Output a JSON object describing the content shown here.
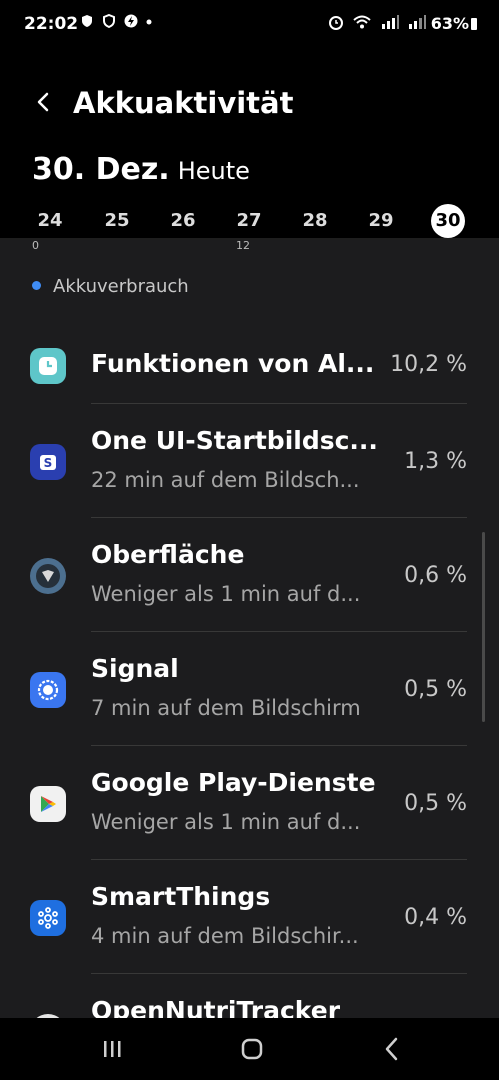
{
  "status_bar": {
    "time": "22:02",
    "battery": "63%"
  },
  "header": {
    "title": "Akkuaktivität"
  },
  "date": {
    "main": "30. Dez.",
    "sub": "Heute"
  },
  "days": [
    "24",
    "25",
    "26",
    "27",
    "28",
    "29",
    "30"
  ],
  "selected_day": "30",
  "chart_ticks": [
    "0",
    "12"
  ],
  "legend": {
    "label": "Akkuverbrauch",
    "color": "#3f8cf4"
  },
  "apps": [
    {
      "name": "Funktionen von Al...",
      "sub": "",
      "percent": "10,2 %",
      "icon": "clock-icon"
    },
    {
      "name": "One UI-Startbildsc...",
      "sub": "22 min auf dem Bildsch...",
      "percent": "1,3 %",
      "icon": "samsung-s-icon"
    },
    {
      "name": "Oberfläche",
      "sub": "Weniger als 1 min auf d...",
      "percent": "0,6 %",
      "icon": "system-ui-icon"
    },
    {
      "name": "Signal",
      "sub": "7 min auf dem Bildschirm",
      "percent": "0,5 %",
      "icon": "signal-icon"
    },
    {
      "name": "Google Play-Dienste",
      "sub": "Weniger als 1 min auf d...",
      "percent": "0,5 %",
      "icon": "google-play-services-icon"
    },
    {
      "name": "SmartThings",
      "sub": "4 min auf dem Bildschir...",
      "percent": "0,4 %",
      "icon": "smartthings-icon"
    },
    {
      "name": "OpenNutriTracker",
      "sub": "",
      "percent": "",
      "icon": "opennutritracker-icon"
    }
  ]
}
